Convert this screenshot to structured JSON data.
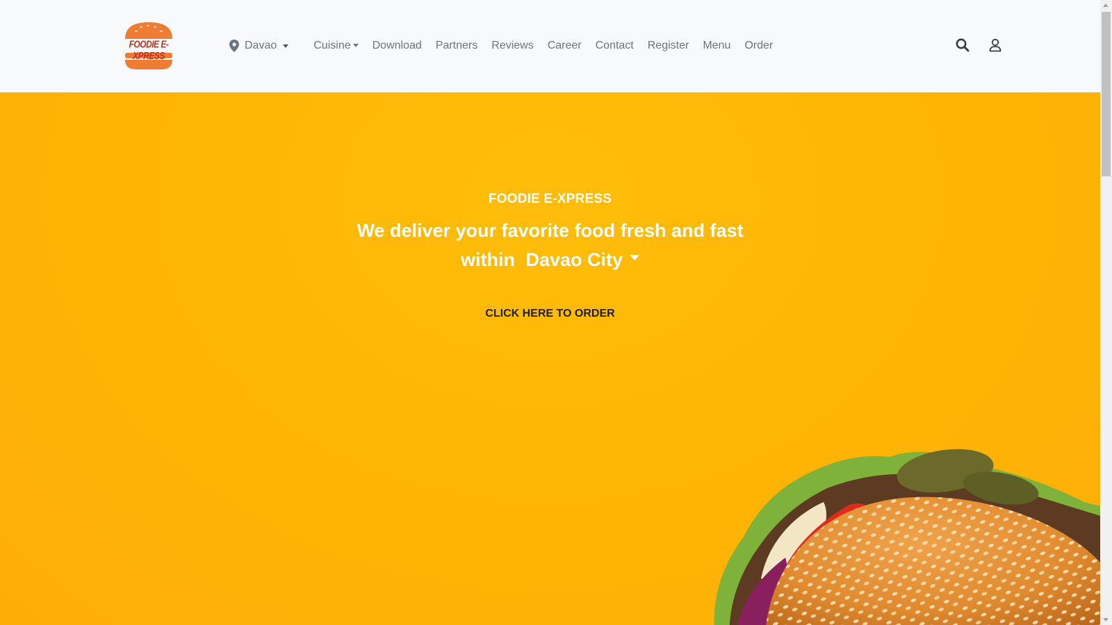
{
  "brand": {
    "logo_text": "FOODIE E-XPRESS",
    "logo_colors": {
      "bun": "#ee7d33",
      "text": "#c0311f"
    }
  },
  "nav": {
    "location_label": "Davao",
    "items": [
      {
        "label": "Cuisine",
        "dropdown": true
      },
      {
        "label": "Download"
      },
      {
        "label": "Partners"
      },
      {
        "label": "Reviews"
      },
      {
        "label": "Career"
      },
      {
        "label": "Contact"
      },
      {
        "label": "Register"
      },
      {
        "label": "Menu"
      },
      {
        "label": "Order"
      }
    ],
    "right_icons": [
      "search-icon",
      "user-icon"
    ]
  },
  "hero": {
    "eyebrow": "FOODIE E-XPRESS",
    "headline_line1": "We deliver your favorite food fresh and fast",
    "headline_prefix": "within",
    "city": "Davao City",
    "cta_label": "CLICK HERE TO ORDER",
    "background_color": "#ffb405"
  }
}
